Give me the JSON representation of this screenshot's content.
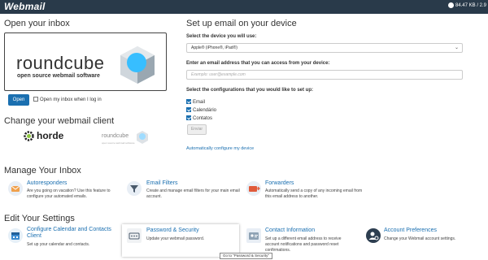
{
  "header": {
    "brand": "Webmail",
    "storage": "84.47 KB / 2.9"
  },
  "inbox": {
    "title": "Open your inbox",
    "logo_word": "roundcube",
    "logo_sub": "open source webmail software",
    "open_label": "Open",
    "open_default_label": "Open my inbox when I log in"
  },
  "clients": {
    "title": "Change your webmail client",
    "horde": "horde",
    "roundcube": "roundcube",
    "roundcube_sub": "open source webmail software"
  },
  "device": {
    "title": "Set up email on your device",
    "select_label": "Select the device you will use:",
    "select_value": "Apple® (iPhone®, iPad®)",
    "email_label": "Enter an email address that you can access from your device:",
    "email_placeholder": "Exemplo: user@example.com",
    "config_label": "Select the configurations that you would like to set up:",
    "configs": [
      "Email",
      "Calendário",
      "Contatos"
    ],
    "enable_label": "Enviar",
    "auto_link": "Automatically configure my device"
  },
  "manage": {
    "title": "Manage Your Inbox",
    "tiles": [
      {
        "title": "Autoresponders",
        "desc": "Are you going on vacation? Use this feature to configure your automated emails."
      },
      {
        "title": "Email Filters",
        "desc": "Create and manage email filters for your main email account."
      },
      {
        "title": "Forwarders",
        "desc": "Automatically send a copy of any incoming email from this email address to another."
      }
    ]
  },
  "settings": {
    "title": "Edit Your Settings",
    "tiles": [
      {
        "title": "Configure Calendar and Contacts Client",
        "desc": "Set up your calendar and contacts."
      },
      {
        "title": "Password & Security",
        "desc": "Update your webmail password."
      },
      {
        "title": "Contact Information",
        "desc": "Set up a different email address to receive account notifications and password reset confirmations."
      },
      {
        "title": "Account Preferences",
        "desc": "Change your Webmail account settings."
      }
    ],
    "tooltip": "Go to \"Password & Security\""
  },
  "colors": {
    "topbar": "#293a4a",
    "accent": "#1a6fb0"
  }
}
